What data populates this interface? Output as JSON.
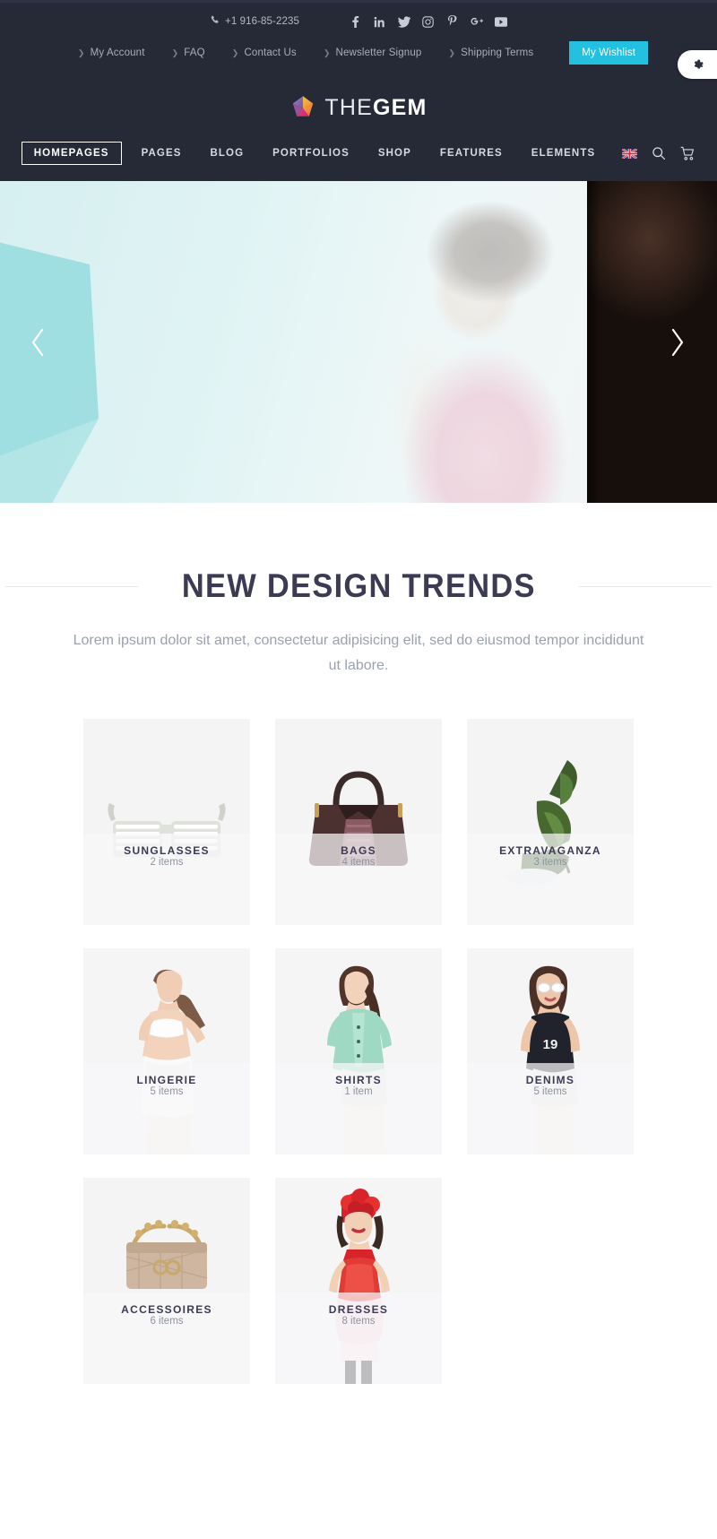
{
  "topbar": {
    "phone": "+1 916-85-2235",
    "phone_icon": "phone-icon",
    "socials": [
      {
        "name": "facebook-icon",
        "label": "Facebook"
      },
      {
        "name": "linkedin-icon",
        "label": "LinkedIn"
      },
      {
        "name": "twitter-icon",
        "label": "Twitter"
      },
      {
        "name": "instagram-icon",
        "label": "Instagram"
      },
      {
        "name": "pinterest-icon",
        "label": "Pinterest"
      },
      {
        "name": "google-plus-icon",
        "label": "Google Plus"
      },
      {
        "name": "youtube-icon",
        "label": "YouTube"
      }
    ],
    "links": [
      {
        "label": "My Account"
      },
      {
        "label": "FAQ"
      },
      {
        "label": "Contact Us"
      },
      {
        "label": "Newsletter Signup"
      },
      {
        "label": "Shipping Terms"
      }
    ],
    "wishlist_label": "My Wishlist",
    "wishlist_color": "#23c0e0",
    "bg_color": "#262936"
  },
  "gear_tab": {
    "icon": "gear-icon"
  },
  "logo": {
    "text_light": "THE",
    "text_bold": "GEM",
    "icon": "gem-pentagon-logo"
  },
  "nav": {
    "items": [
      {
        "label": "HOMEPAGES",
        "active": true
      },
      {
        "label": "PAGES",
        "active": false
      },
      {
        "label": "BLOG",
        "active": false
      },
      {
        "label": "PORTFOLIOS",
        "active": false
      },
      {
        "label": "SHOP",
        "active": false
      },
      {
        "label": "FEATURES",
        "active": false
      },
      {
        "label": "ELEMENTS",
        "active": false
      }
    ],
    "icons": [
      {
        "name": "uk-flag-icon"
      },
      {
        "name": "search-icon"
      },
      {
        "name": "cart-icon"
      }
    ]
  },
  "hero": {
    "prev_icon": "chevron-left-icon",
    "next_icon": "chevron-right-icon",
    "bg_color": "#dff1f2",
    "accent_shape_color": "#8fd9dd"
  },
  "section": {
    "title": "NEW DESIGN TRENDS",
    "subtitle": "Lorem ipsum dolor sit amet, consectetur adipisicing elit, sed do eiusmod tempor incididunt ut labore.",
    "divider_color": "#23c0e0"
  },
  "categories": [
    {
      "name": "SUNGLASSES",
      "count": "2 items",
      "art": "sunglasses"
    },
    {
      "name": "BAGS",
      "count": "4 items",
      "art": "bag"
    },
    {
      "name": "EXTRAVAGANZA",
      "count": "3 items",
      "art": "shoe"
    },
    {
      "name": "LINGERIE",
      "count": "5 items",
      "art": "model-lingerie"
    },
    {
      "name": "SHIRTS",
      "count": "1 item",
      "art": "model-shirt"
    },
    {
      "name": "DENIMS",
      "count": "5 items",
      "art": "model-denim"
    },
    {
      "name": "ACCESSOIRES",
      "count": "6 items",
      "art": "chain-bag"
    },
    {
      "name": "DRESSES",
      "count": "8 items",
      "art": "model-dress"
    }
  ]
}
